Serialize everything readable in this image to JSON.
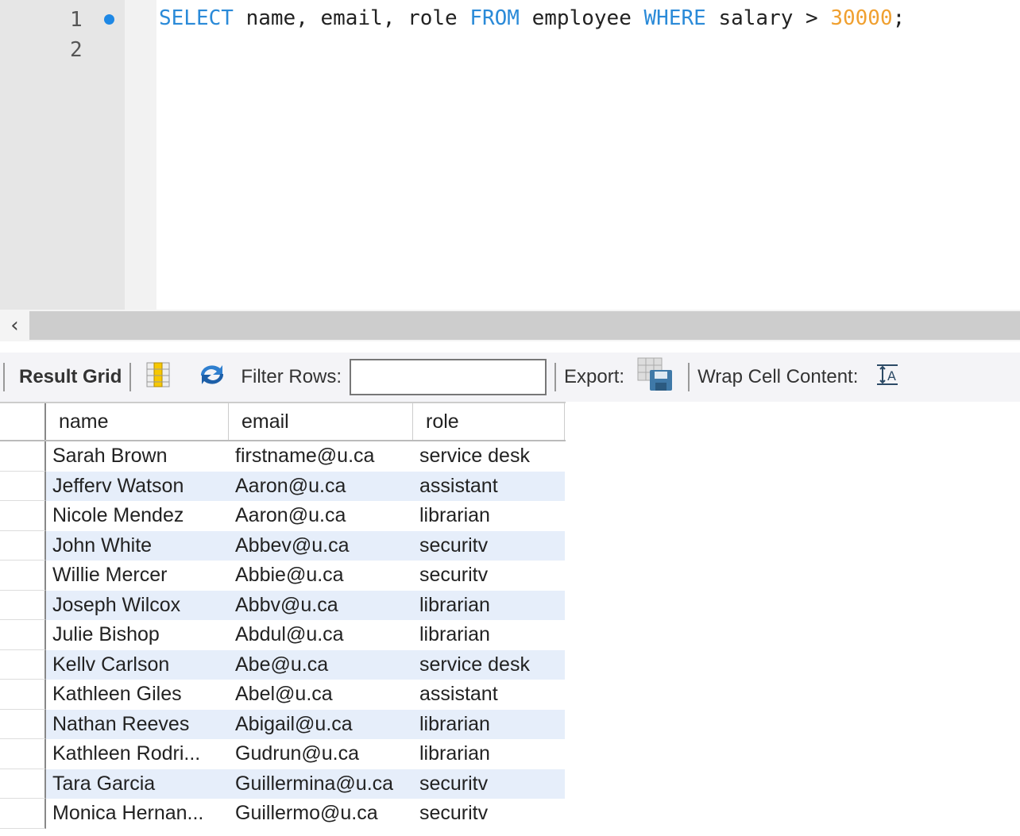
{
  "editor": {
    "line_numbers": [
      "1",
      "2"
    ],
    "code": {
      "t1": "SELECT",
      "t2": " name, email, role ",
      "t3": "FROM",
      "t4": " employee ",
      "t5": "WHERE",
      "t6": " salary > ",
      "t7": "30000",
      "t8": ";"
    }
  },
  "toolbar": {
    "result_grid": "Result Grid",
    "filter_label": "Filter Rows:",
    "filter_value": "",
    "export_label": "Export:",
    "wrap_label": "Wrap Cell Content:"
  },
  "grid": {
    "columns": [
      "name",
      "email",
      "role"
    ],
    "rows": [
      [
        "Sarah Brown",
        "firstname@u.ca",
        "service desk"
      ],
      [
        "Jefferv Watson",
        "Aaron@u.ca",
        "assistant"
      ],
      [
        "Nicole Mendez",
        "Aaron@u.ca",
        "librarian"
      ],
      [
        "John White",
        "Abbev@u.ca",
        "securitv"
      ],
      [
        "Willie Mercer",
        "Abbie@u.ca",
        "securitv"
      ],
      [
        "Joseph Wilcox",
        "Abbv@u.ca",
        "librarian"
      ],
      [
        "Julie Bishop",
        "Abdul@u.ca",
        "librarian"
      ],
      [
        "Kellv Carlson",
        "Abe@u.ca",
        "service desk"
      ],
      [
        "Kathleen Giles",
        "Abel@u.ca",
        "assistant"
      ],
      [
        "Nathan Reeves",
        "Abigail@u.ca",
        "librarian"
      ],
      [
        "Kathleen Rodri...",
        "Gudrun@u.ca",
        "librarian"
      ],
      [
        "Tara Garcia",
        "Guillermina@u.ca",
        "securitv"
      ],
      [
        "Monica Hernan...",
        "Guillermo@u.ca",
        "securitv"
      ]
    ]
  }
}
